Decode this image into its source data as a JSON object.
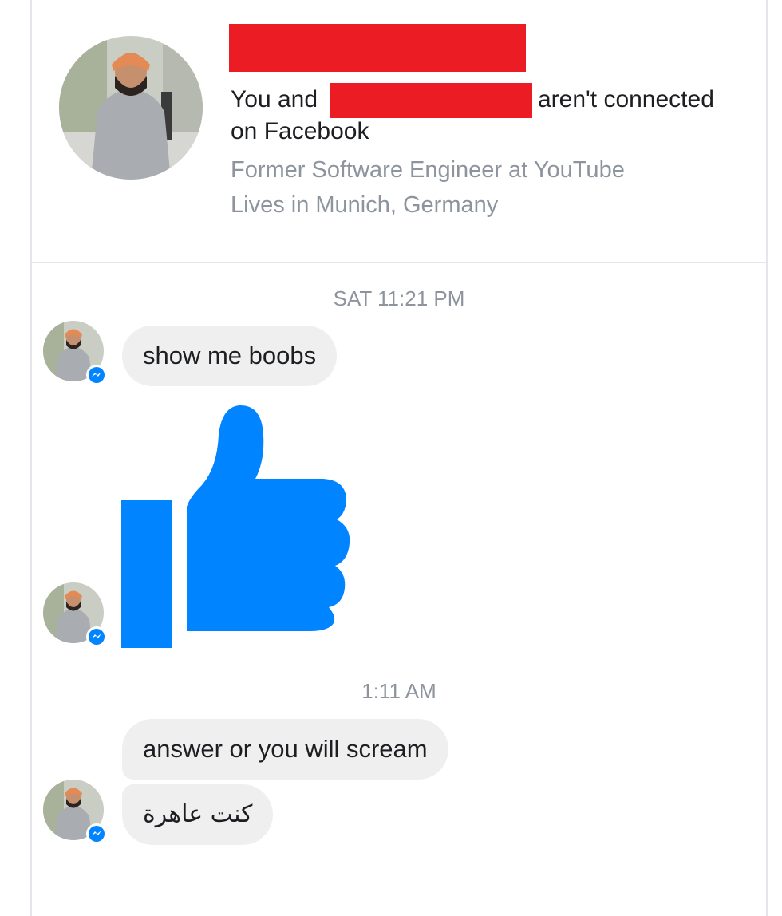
{
  "header": {
    "line1_prefix": "You and",
    "line1_suffix": "aren't connected",
    "line2": "on Facebook",
    "work": "Former Software Engineer at YouTube",
    "location": "Lives in Munich, Germany"
  },
  "conversation": {
    "timestamps": [
      "SAT 11:21 PM",
      "1:11 AM"
    ],
    "messages": [
      {
        "sender": "contact",
        "type": "text",
        "text": "show me boobs"
      },
      {
        "sender": "contact",
        "type": "sticker",
        "icon": "thumbs-up-icon"
      },
      {
        "sender": "contact",
        "type": "text",
        "text": "answer or you will scream"
      },
      {
        "sender": "contact",
        "type": "text",
        "text": "كنت عاهرة"
      }
    ]
  },
  "colors": {
    "redaction": "#ec1c24",
    "messenger_blue": "#0084ff",
    "bubble_gray": "#efefef",
    "secondary_text": "#8d949e"
  }
}
